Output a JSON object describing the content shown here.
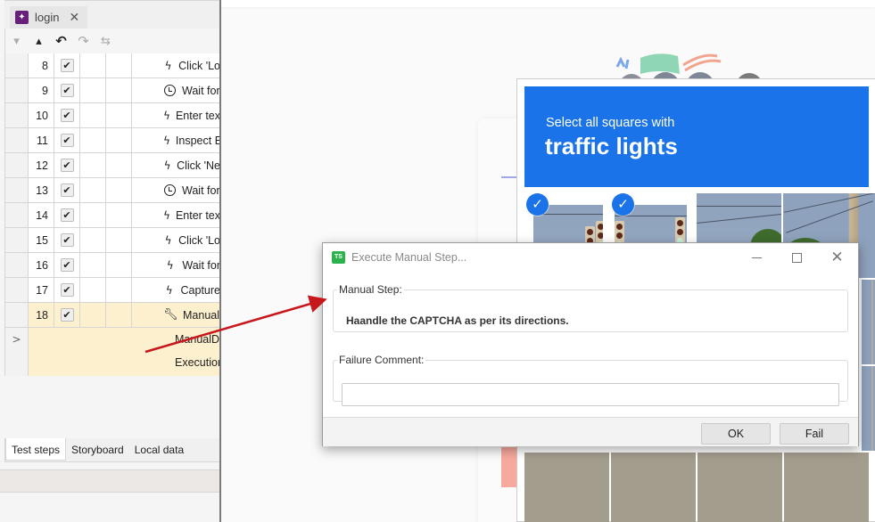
{
  "ide": {
    "document_tab": {
      "label": "login",
      "icon": "test-case-icon"
    },
    "toolbar": [
      {
        "name": "move-down-icon",
        "glyph": "▾",
        "enabled": false
      },
      {
        "name": "move-up-icon",
        "glyph": "▴",
        "enabled": true
      },
      {
        "name": "undo-icon",
        "glyph": "↶",
        "enabled": true
      },
      {
        "name": "redo-icon",
        "glyph": "↷",
        "enabled": false
      },
      {
        "name": "module-icon",
        "glyph": "⇆",
        "enabled": false
      }
    ],
    "steps": [
      {
        "num": "8",
        "checked": true,
        "icon": "bolt-icon",
        "text": "Click 'Lo"
      },
      {
        "num": "9",
        "checked": true,
        "icon": "clock-icon",
        "text": "Wait for"
      },
      {
        "num": "10",
        "checked": true,
        "icon": "bolt-icon",
        "text": "Enter tex"
      },
      {
        "num": "11",
        "checked": true,
        "icon": "bolt-icon",
        "text": "Inspect E"
      },
      {
        "num": "12",
        "checked": true,
        "icon": "bolt-icon",
        "text": "Click 'Ne"
      },
      {
        "num": "13",
        "checked": true,
        "icon": "clock-icon",
        "text": "Wait for"
      },
      {
        "num": "14",
        "checked": true,
        "icon": "bolt-icon",
        "text": "Enter tex"
      },
      {
        "num": "15",
        "checked": true,
        "icon": "bolt-icon",
        "text": "Click 'Lo"
      },
      {
        "num": "16",
        "checked": true,
        "icon": "bolt-icon",
        "text": "Wait for"
      },
      {
        "num": "17",
        "checked": true,
        "icon": "bolt-icon",
        "text": "Capture"
      },
      {
        "num": "18",
        "checked": true,
        "icon": "wrench-icon",
        "text": "Manual:",
        "selected": true
      }
    ],
    "detail": {
      "expander": ">",
      "line1": "ManualDe",
      "line2": "Execution"
    },
    "bottom_tabs": [
      {
        "label": "Test steps",
        "active": true
      },
      {
        "label": "Storyboard",
        "active": false
      },
      {
        "label": "Local data",
        "active": false
      }
    ]
  },
  "captcha": {
    "instruction": "Select all squares with",
    "target": "traffic lights",
    "accent_color": "#1a73e8",
    "selected_tiles": [
      0,
      1
    ]
  },
  "dialog": {
    "title": "Execute Manual Step...",
    "icon_text": "TS",
    "manual_step_label": "Manual Step:",
    "manual_step_text": "Haandle the CAPTCHA as per its directions.",
    "failure_comment_label": "Failure Comment:",
    "failure_comment_value": "",
    "ok_label": "OK",
    "fail_label": "Fail",
    "close_glyph": "✕"
  },
  "colors": {
    "selected_row": "#fdf0cf",
    "annotation_arrow": "#c8161d",
    "ts_icon": "#2bb24c"
  }
}
